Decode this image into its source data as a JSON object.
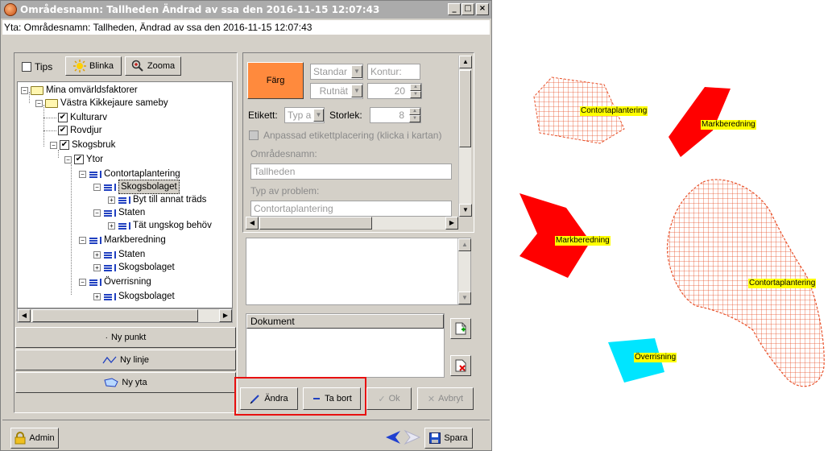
{
  "window": {
    "title": "Områdesnamn: Tallheden Ändrad av ssa den 2016-11-15 12:07:43",
    "status": "Yta: Områdesnamn: Tallheden, Ändrad av ssa den 2016-11-15 12:07:43",
    "controls": {
      "minimize": "_",
      "maximize": "□",
      "close": "×"
    }
  },
  "toolbar": {
    "tips_label": "Tips",
    "tips_checked": false,
    "blinka_label": "Blinka",
    "zooma_label": "Zooma"
  },
  "tree": {
    "root": "Mina omvärldsfaktorer",
    "sameby": "Västra Kikkejaure sameby",
    "kulturarv": "Kulturarv",
    "rovdjur": "Rovdjur",
    "skogsbruk": "Skogsbruk",
    "ytor": "Ytor",
    "contorta": "Contortaplantering",
    "skogsbolaget1": "Skogsbolaget",
    "byt": "Byt till annat träds",
    "staten1": "Staten",
    "tat": "Tät ungskog behöv",
    "markberedning": "Markberedning",
    "staten2": "Staten",
    "skogsbolaget2": "Skogsbolaget",
    "overrisning": "Överrisning",
    "skogsbolaget3": "Skogsbolaget"
  },
  "actions": {
    "ny_punkt": "Ny punkt",
    "ny_linje": "Ny linje",
    "ny_yta": "Ny yta"
  },
  "footer": {
    "admin": "Admin",
    "spara": "Spara"
  },
  "props": {
    "farg_label": "Färg",
    "farg_color": "#ff8a3d",
    "standard": "Standar",
    "kontur": "Kontur:",
    "rutnat": "Rutnät",
    "width_value": "20",
    "etikett_label": "Etikett:",
    "etikett_value": "Typ a",
    "storlek_label": "Storlek:",
    "storlek_value": "8",
    "anpassad": "Anpassad etikettplacering (klicka i kartan)",
    "omradesnamn_label": "Områdesnamn:",
    "omradesnamn_value": "Tallheden",
    "typ_label": "Typ av problem:",
    "typ_value": "Contortaplantering"
  },
  "documents": {
    "header": "Dokument"
  },
  "edit_buttons": {
    "andra": "Ändra",
    "ta_bort": "Ta bort",
    "ok": "Ok",
    "avbryt": "Avbryt"
  },
  "map": {
    "labels": {
      "contorta_top": "Contortaplantering",
      "mark_top": "Markberedning",
      "mark_left": "Markberedning",
      "contorta_right": "Contortaplantering",
      "overrisning": "Överrisning"
    },
    "colors": {
      "red": "#ff0000",
      "cyan": "#00e5ff",
      "hatch": "#e8512a",
      "label_bg": "#ffff00"
    }
  }
}
